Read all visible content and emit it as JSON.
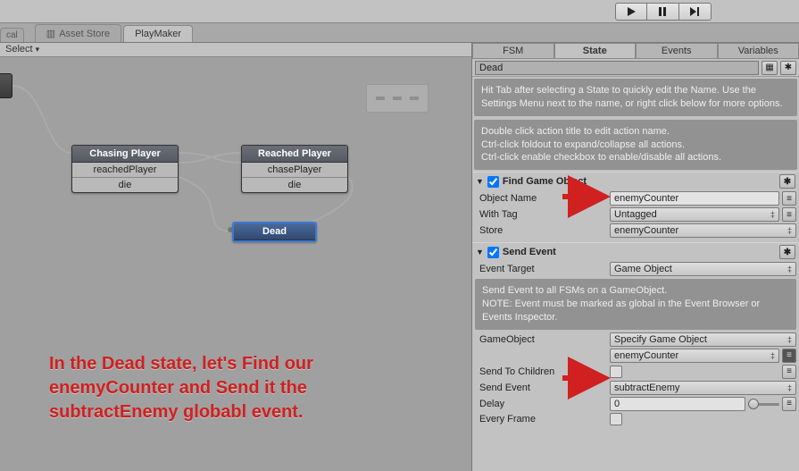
{
  "topTabs": {
    "cal": "cal",
    "assetStore": "Asset Store",
    "playMaker": "PlayMaker"
  },
  "select": "Select",
  "graph": {
    "nodes": [
      {
        "title": "Chasing Player",
        "rows": [
          "reachedPlayer",
          "die"
        ]
      },
      {
        "title": "Reached Player",
        "rows": [
          "chasePlayer",
          "die"
        ]
      },
      {
        "title": "Dead",
        "rows": []
      }
    ]
  },
  "annotation": {
    "l1": "In the Dead state, let's Find our",
    "l2": "enemyCounter and Send it the",
    "l3": "subtractEnemy globabl event."
  },
  "inspector": {
    "tabs": [
      "FSM",
      "State",
      "Events",
      "Variables"
    ],
    "stateName": "Dead",
    "help1": "Hit Tab after selecting a State to quickly edit the Name. Use the Settings Menu next to the name, or right click below for more options.",
    "help2": "Double click action title to edit action name.\nCtrl-click foldout to expand/collapse all actions.\nCtrl-click enable checkbox to enable/disable all actions.",
    "findGameObject": {
      "title": "Find Game Object",
      "objectName": {
        "label": "Object Name",
        "value": "enemyCounter"
      },
      "withTag": {
        "label": "With Tag",
        "value": "Untagged"
      },
      "store": {
        "label": "Store",
        "value": "enemyCounter"
      }
    },
    "sendEvent": {
      "title": "Send Event",
      "eventTarget": {
        "label": "Event Target",
        "value": "Game Object"
      },
      "help": "Send Event to all FSMs on a GameObject.\nNOTE: Event must be marked as global in the Event Browser or Events Inspector.",
      "gameObject": {
        "label": "GameObject",
        "value": "Specify Game Object",
        "target": "enemyCounter"
      },
      "sendToChildren": {
        "label": "Send To Children"
      },
      "sendEventField": {
        "label": "Send Event",
        "value": "subtractEnemy"
      },
      "delay": {
        "label": "Delay",
        "value": "0"
      },
      "everyFrame": {
        "label": "Every Frame"
      }
    }
  }
}
